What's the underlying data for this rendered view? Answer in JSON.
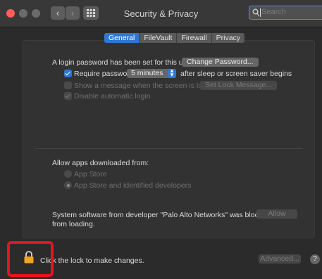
{
  "window": {
    "title": "Security & Privacy",
    "search_placeholder": "Search"
  },
  "tabs": [
    {
      "label": "General",
      "active": true
    },
    {
      "label": "FileVault",
      "active": false
    },
    {
      "label": "Firewall",
      "active": false
    },
    {
      "label": "Privacy",
      "active": false
    }
  ],
  "login": {
    "text": "A login password has been set for this user",
    "change_button": "Change Password...",
    "require_label": "Require password",
    "require_value": "5 minutes",
    "require_suffix": "after sleep or screen saver begins",
    "show_message_label": "Show a message when the screen is locked",
    "set_lock_button": "Set Lock Message...",
    "disable_auto_login": "Disable automatic login"
  },
  "allow_apps": {
    "heading": "Allow apps downloaded from:",
    "option_app_store": "App Store",
    "option_identified": "App Store and identified developers"
  },
  "blocked": {
    "line1": "System software from developer \"Palo Alto Networks\" was blocked",
    "line2": "from loading.",
    "allow_button": "Allow"
  },
  "footer": {
    "lock_text": "Click the lock to make changes.",
    "advanced_button": "Advanced...",
    "help": "?"
  },
  "colors": {
    "accent": "#2f77d4",
    "highlight": "#e8131b",
    "close": "#fe5f57"
  }
}
